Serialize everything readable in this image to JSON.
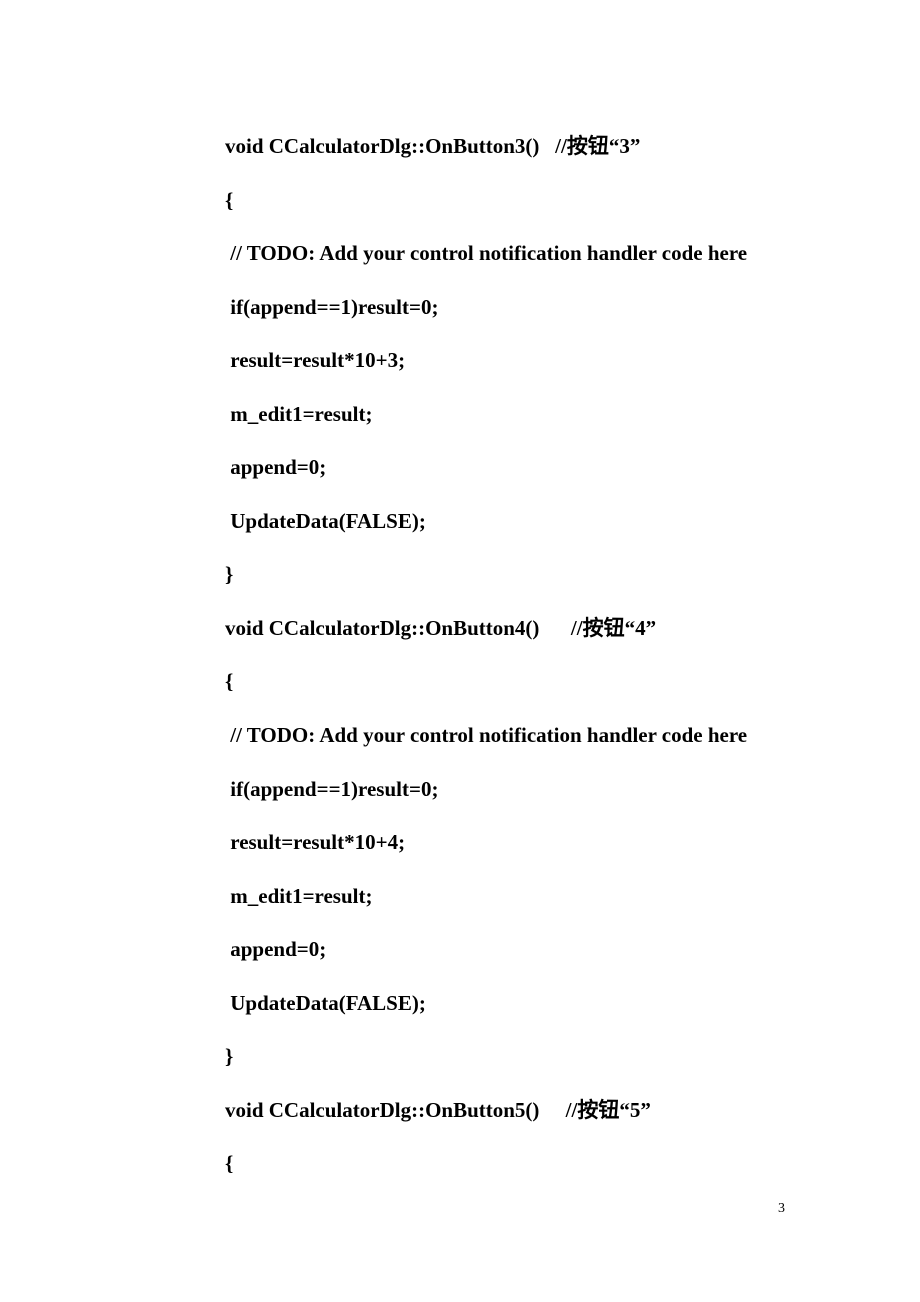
{
  "code": {
    "lines": [
      "void CCalculatorDlg::OnButton3()   //按钮“3”",
      "{",
      " // TODO: Add your control notification handler code here",
      " if(append==1)result=0;",
      " result=result*10+3;",
      " m_edit1=result;",
      " append=0;",
      " UpdateData(FALSE);",
      "}",
      "void CCalculatorDlg::OnButton4()      //按钮“4”",
      "{",
      " // TODO: Add your control notification handler code here",
      " if(append==1)result=0;",
      " result=result*10+4;",
      " m_edit1=result;",
      " append=0;",
      " UpdateData(FALSE);",
      "}",
      "void CCalculatorDlg::OnButton5()     //按钮“5”",
      "{"
    ]
  },
  "page_number": "3"
}
